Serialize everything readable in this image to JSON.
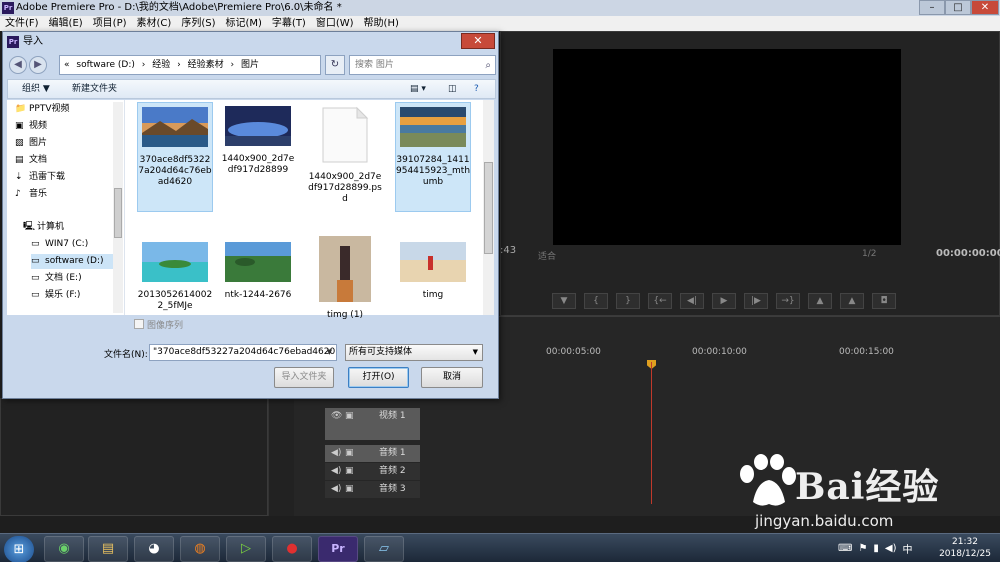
{
  "app": {
    "title": "Adobe Premiere Pro - D:\\我的文档\\Adobe\\Premiere Pro\\6.0\\未命名 *",
    "logo": "Pr",
    "menu": [
      "文件(F)",
      "编辑(E)",
      "项目(P)",
      "素材(C)",
      "序列(S)",
      "标记(M)",
      "字幕(T)",
      "窗口(W)",
      "帮助(H)"
    ]
  },
  "monitor": {
    "timecode_left": ":43",
    "fit": "适合",
    "ratio": "1/2",
    "timecode_right": "00:00:00:00"
  },
  "timeline": {
    "ruler": [
      "00:00:05:00",
      "00:00:10:00",
      "00:00:15:00"
    ],
    "tracks": [
      {
        "name": "视频 1"
      },
      {
        "name": "音频 1"
      },
      {
        "name": "音频 2"
      },
      {
        "name": "音频 3"
      }
    ]
  },
  "dialog": {
    "title": "导入",
    "logo": "Pr",
    "address": [
      "«",
      "software (D:)",
      "›",
      "经验",
      "›",
      "经验素材",
      "›",
      "图片"
    ],
    "search_placeholder": "搜索 图片",
    "organize": "组织 ▼",
    "new_folder": "新建文件夹",
    "nav_items": [
      {
        "label": "PPTV视频",
        "icon": "folder-icon"
      },
      {
        "label": "视频",
        "icon": "video-library-icon"
      },
      {
        "label": "图片",
        "icon": "picture-library-icon"
      },
      {
        "label": "文档",
        "icon": "document-library-icon"
      },
      {
        "label": "迅雷下载",
        "icon": "download-icon"
      },
      {
        "label": "音乐",
        "icon": "music-library-icon"
      },
      {
        "label": "计算机",
        "icon": "computer-icon"
      },
      {
        "label": "WIN7 (C:)",
        "icon": "system-drive-icon"
      },
      {
        "label": "software (D:)",
        "icon": "drive-icon"
      },
      {
        "label": "文档 (E:)",
        "icon": "drive-icon"
      },
      {
        "label": "娱乐 (F:)",
        "icon": "drive-icon"
      }
    ],
    "files": [
      {
        "name": "370ace8df5322\n7a204d64c76eb\nad4620",
        "selected": true
      },
      {
        "name": "1440x900_2d7e\ndf917d28899",
        "selected": false
      },
      {
        "name": "1440x900_2d7e\ndf917d28899.ps\nd",
        "selected": false
      },
      {
        "name": "39107284_1411\n954415923_mth\numb",
        "selected": true
      },
      {
        "name": "2013052614002\n2_5fMJe",
        "selected": false
      },
      {
        "name": "ntk-1244-2676",
        "selected": false
      },
      {
        "name": "timg (1)",
        "selected": false
      },
      {
        "name": "timg",
        "selected": false
      }
    ],
    "image_sequence": "图像序列",
    "filename_label": "文件名(N):",
    "filename_value": "\"370ace8df53227a204d64c76ebad4620\" \"",
    "filter": "所有可支持媒体",
    "btn_import_folder": "导入文件夹",
    "btn_open": "打开(O)",
    "btn_cancel": "取消"
  },
  "taskbar": {
    "clock_time": "21:32",
    "clock_date": "2018/12/25",
    "apps": [
      "360-browser-icon",
      "file-explorer-icon",
      "qq-icon",
      "firefox-icon",
      "media-player-icon",
      "screen-recorder-icon",
      "premiere-icon",
      "tablet-icon"
    ]
  },
  "watermark": {
    "text": "Bai经验",
    "url": "jingyan.baidu.com"
  },
  "colors": {
    "accent_blue": "#3b7fc4",
    "selection": "#cde6f8",
    "playhead": "#c0392b",
    "premiere_purple": "#2a1a5e"
  }
}
